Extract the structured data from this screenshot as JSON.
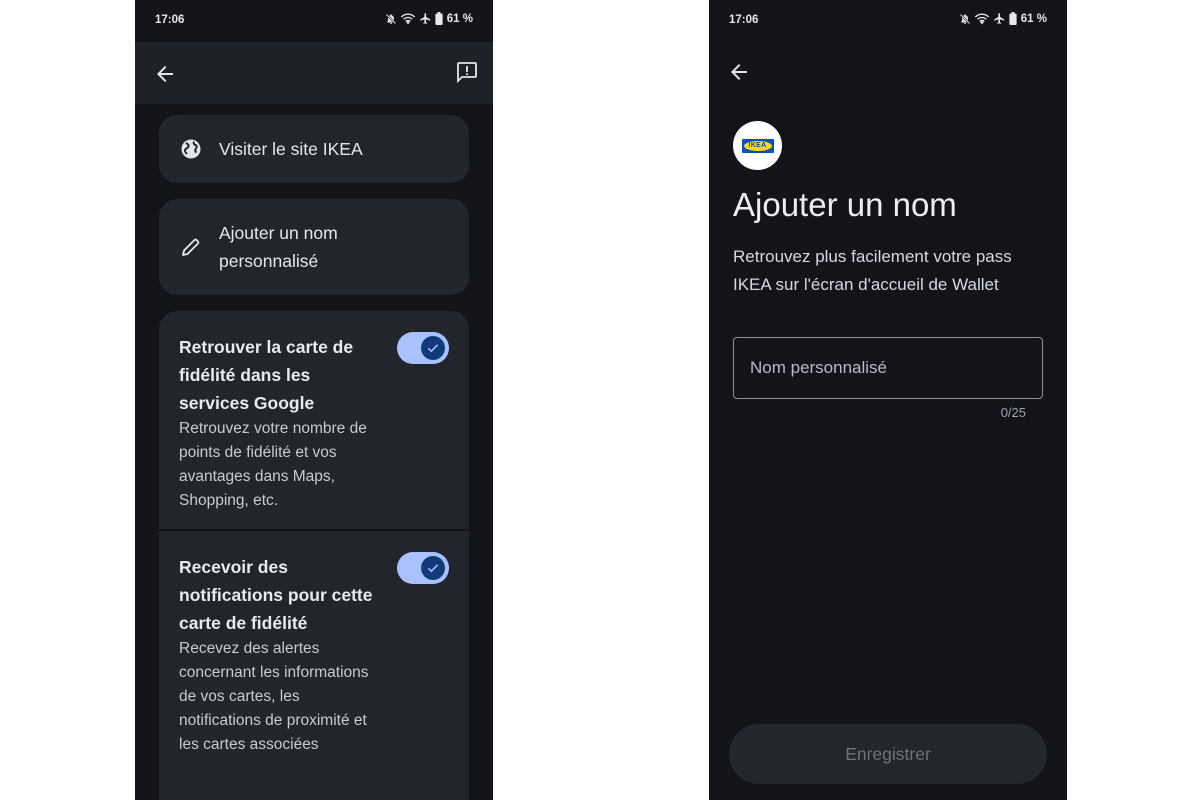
{
  "status": {
    "time": "17:06",
    "battery": "61 %"
  },
  "left": {
    "items": [
      {
        "label": "Visiter le site IKEA",
        "icon": "globe-icon"
      },
      {
        "label": "Ajouter un nom personnalisé",
        "icon": "pencil-icon"
      }
    ],
    "toggles": [
      {
        "title": "Retrouver la carte de fidélité dans les services Google",
        "description": "Retrouvez votre nombre de points de fidélité et vos avantages dans Maps, Shopping, etc.",
        "on": true
      },
      {
        "title": "Recevoir des notifications pour cette carte de fidélité",
        "description": "Recevez des alertes concernant les informations de vos cartes, les notifications de proximité et les cartes associées",
        "on": true
      }
    ]
  },
  "right": {
    "logo_text": "IKEA",
    "title": "Ajouter un nom",
    "description": "Retrouvez plus facilement votre pass IKEA sur l'écran d'accueil de Wallet",
    "input_placeholder": "Nom personnalisé",
    "input_value": "",
    "counter": "0/25",
    "save_label": "Enregistrer"
  },
  "colors": {
    "background": "#12141a",
    "card": "#23252e",
    "switch_track": "#a9c1ff",
    "switch_knob": "#123a78",
    "ikea_blue": "#0051ba",
    "ikea_yellow": "#ffda1a"
  }
}
